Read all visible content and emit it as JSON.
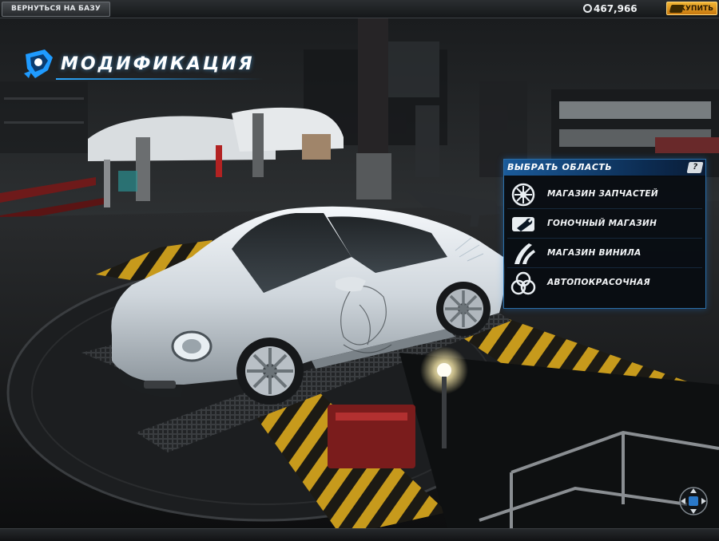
{
  "topbar": {
    "back_label": "ВЕРНУТЬСЯ НА БАЗУ",
    "currency_value": "467,966",
    "currency_icon": "cash-icon",
    "buy_label": "КУПИТЬ",
    "buy_icon": "boost-card-icon"
  },
  "title": {
    "text": "МОДИФИКАЦИЯ",
    "logo_icon": "modification-logo-icon",
    "accent_color": "#2aa7ff"
  },
  "panel": {
    "title": "ВЫБРАТЬ ОБЛАСТЬ",
    "help_label": "?",
    "items": [
      {
        "label": "МАГАЗИН ЗАПЧАСТЕЙ",
        "icon": "wheel-icon"
      },
      {
        "label": "ГОНОЧНЫЙ МАГАЗИН",
        "icon": "wrench-icon"
      },
      {
        "label": "МАГАЗИН ВИНИЛА",
        "icon": "vinyl-stripes-icon"
      },
      {
        "label": "АВТОПОКРАСОЧНАЯ",
        "icon": "paint-circles-icon"
      }
    ]
  },
  "nav": {
    "icon": "camera-compass-icon"
  }
}
